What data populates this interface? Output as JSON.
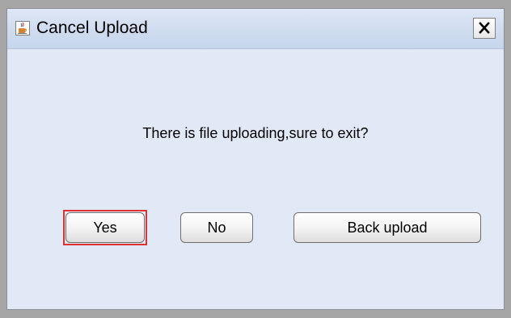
{
  "dialog": {
    "title": "Cancel Upload",
    "close_label": "✕",
    "message": "There is file uploading,sure to exit?",
    "buttons": {
      "yes": "Yes",
      "no": "No",
      "back_upload": "Back upload"
    },
    "icons": {
      "app": "java-cup-icon",
      "close": "close-icon"
    },
    "colors": {
      "background": "#e2e9f6",
      "title_bar": "#cfdcef",
      "highlight": "#e03131"
    }
  }
}
